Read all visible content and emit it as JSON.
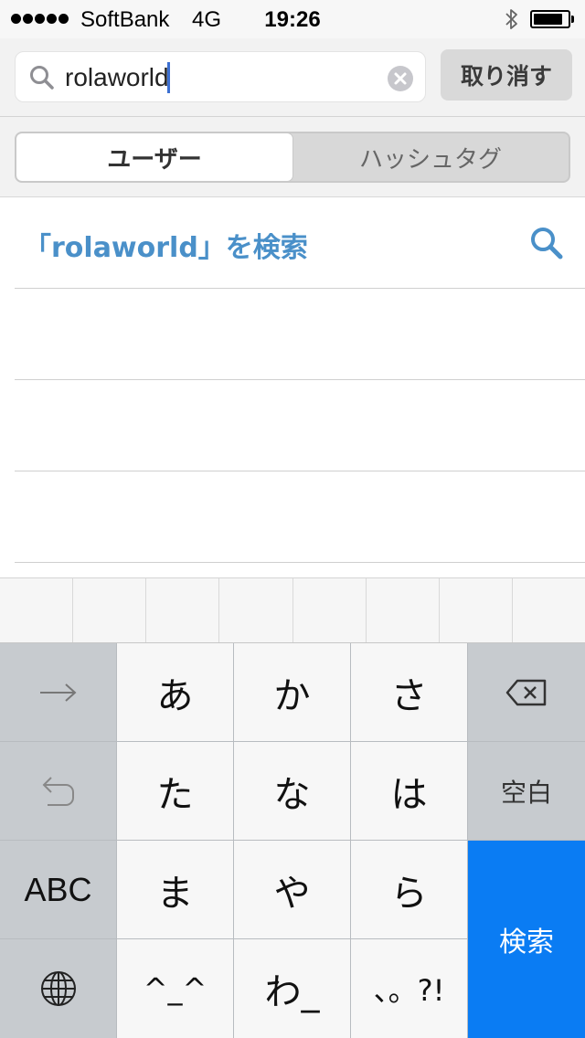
{
  "status_bar": {
    "carrier": "SoftBank",
    "network": "4G",
    "time": "19:26",
    "signal_bars": 5,
    "battery_level": 0.85
  },
  "search": {
    "query": "rolaworld",
    "cancel_label": "取り消す"
  },
  "segments": {
    "users_label": "ユーザー",
    "hashtags_label": "ハッシュタグ",
    "selected": "ユーザー"
  },
  "results": {
    "search_suggestion": "「rolaworld」を検索"
  },
  "keyboard": {
    "row1": {
      "key1": "あ",
      "key2": "か",
      "key3": "さ"
    },
    "row2": {
      "key1": "た",
      "key2": "な",
      "key3": "は",
      "space": "空白"
    },
    "row3": {
      "abc": "ABC",
      "key1": "ま",
      "key2": "や",
      "key3": "ら"
    },
    "row4": {
      "key1": "^_^",
      "key2": "わ_",
      "key3": "、。?!"
    },
    "search_key": "検索"
  },
  "colors": {
    "accent_blue": "#0a7cf3",
    "link_blue": "#4a90c9",
    "key_dark": "#c7cbcf",
    "key_light": "#f7f7f7"
  },
  "icons": [
    "bluetooth-icon",
    "search-icon",
    "clear-icon",
    "arrow-right-icon",
    "backspace-icon",
    "undo-icon",
    "globe-icon"
  ]
}
